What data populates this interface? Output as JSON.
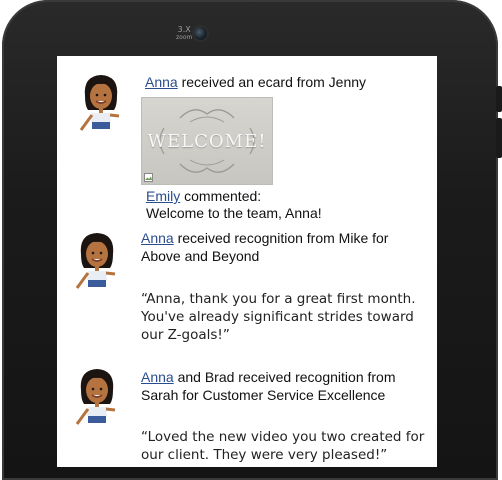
{
  "device": {
    "camera_label_top": "3.X",
    "camera_label_bottom": "zoom"
  },
  "feed": {
    "items": [
      {
        "name": "Anna",
        "rest": " received an ecard from Jenny",
        "ecard_title": "WELCOME!",
        "comment_author": "Emily",
        "comment_prefix": " commented:",
        "comment_text": "Welcome to the team, Anna!"
      },
      {
        "name": "Anna",
        "rest_line1": " received recognition from Mike for",
        "rest_line2": "Above and Beyond",
        "quote_line1": "“Anna, thank you for a great first month.",
        "quote_line2": "You've already significant strides toward",
        "quote_line3": "our Z-goals!”"
      },
      {
        "name": "Anna",
        "rest_line1": " and Brad received recognition from",
        "rest_line2": "Sarah for Customer Service Excellence",
        "quote_line1": "“Loved the new video you two created for",
        "quote_line2": "our client.  They were very pleased!”"
      }
    ]
  }
}
